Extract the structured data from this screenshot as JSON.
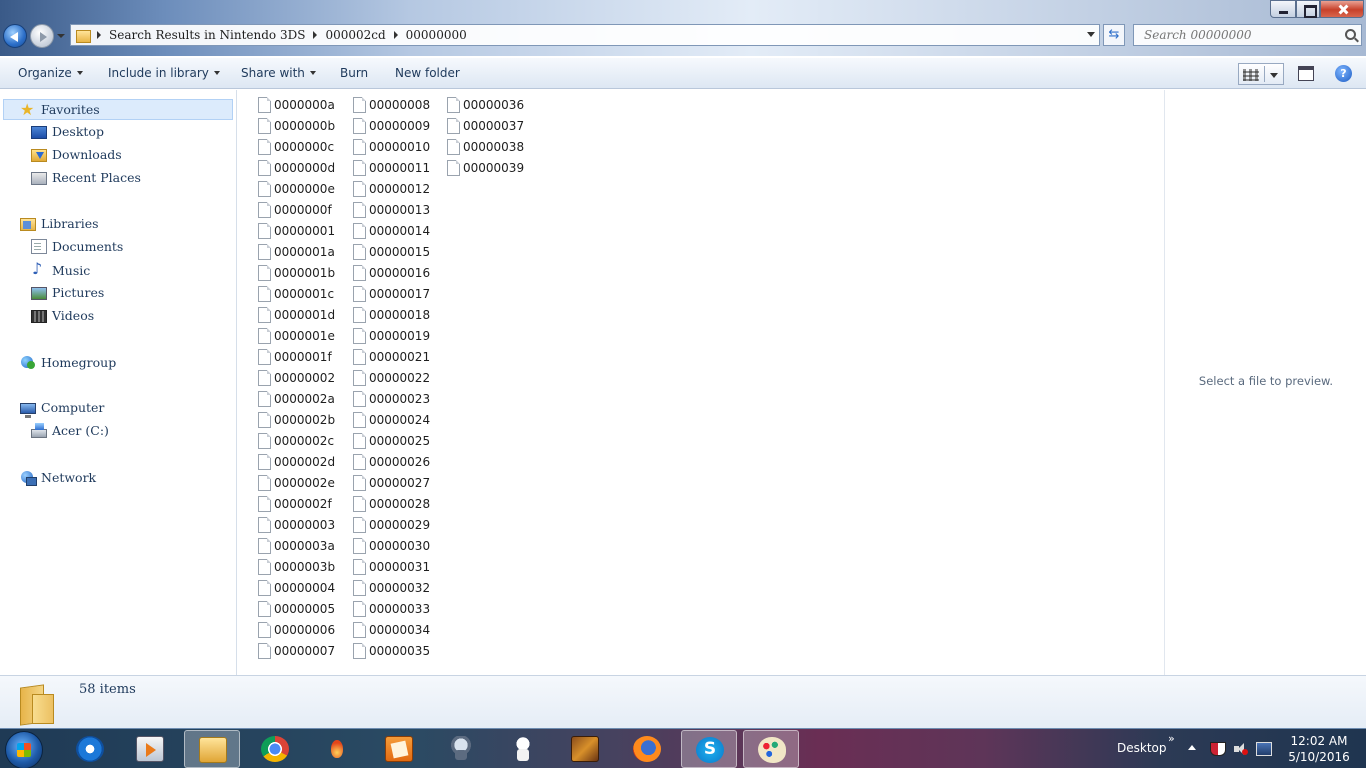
{
  "window": {
    "address": {
      "crumbs": [
        "Search Results in Nintendo 3DS",
        "000002cd",
        "00000000"
      ]
    },
    "search": {
      "placeholder": "Search 00000000"
    }
  },
  "commandbar": {
    "organize": "Organize",
    "include_in_library": "Include in library",
    "share_with": "Share with",
    "burn": "Burn",
    "new_folder": "New folder",
    "help": "?"
  },
  "navpane": {
    "favorites": {
      "label": "Favorites",
      "items": [
        "Desktop",
        "Downloads",
        "Recent Places"
      ]
    },
    "libraries": {
      "label": "Libraries",
      "items": [
        "Documents",
        "Music",
        "Pictures",
        "Videos"
      ]
    },
    "homegroup": {
      "label": "Homegroup"
    },
    "computer": {
      "label": "Computer",
      "items": [
        "Acer (C:)"
      ]
    },
    "network": {
      "label": "Network"
    }
  },
  "files": {
    "columns": [
      [
        "0000000a",
        "0000000b",
        "0000000c",
        "0000000d",
        "0000000e",
        "0000000f",
        "00000001",
        "0000001a",
        "0000001b",
        "0000001c",
        "0000001d",
        "0000001e",
        "0000001f",
        "00000002",
        "0000002a",
        "0000002b",
        "0000002c",
        "0000002d",
        "0000002e",
        "0000002f",
        "00000003",
        "0000003a",
        "0000003b",
        "00000004",
        "00000005",
        "00000006",
        "00000007"
      ],
      [
        "00000008",
        "00000009",
        "00000010",
        "00000011",
        "00000012",
        "00000013",
        "00000014",
        "00000015",
        "00000016",
        "00000017",
        "00000018",
        "00000019",
        "00000021",
        "00000022",
        "00000023",
        "00000024",
        "00000025",
        "00000026",
        "00000027",
        "00000028",
        "00000029",
        "00000030",
        "00000031",
        "00000032",
        "00000033",
        "00000034",
        "00000035"
      ],
      [
        "00000036",
        "00000037",
        "00000038",
        "00000039"
      ]
    ]
  },
  "preview": {
    "empty_text": "Select a file to preview."
  },
  "details": {
    "item_count": "58 items"
  },
  "taskbar": {
    "desktop_label": "Desktop",
    "chevron": "»",
    "clock": {
      "time": "12:02 AM",
      "date": "5/10/2016"
    }
  }
}
